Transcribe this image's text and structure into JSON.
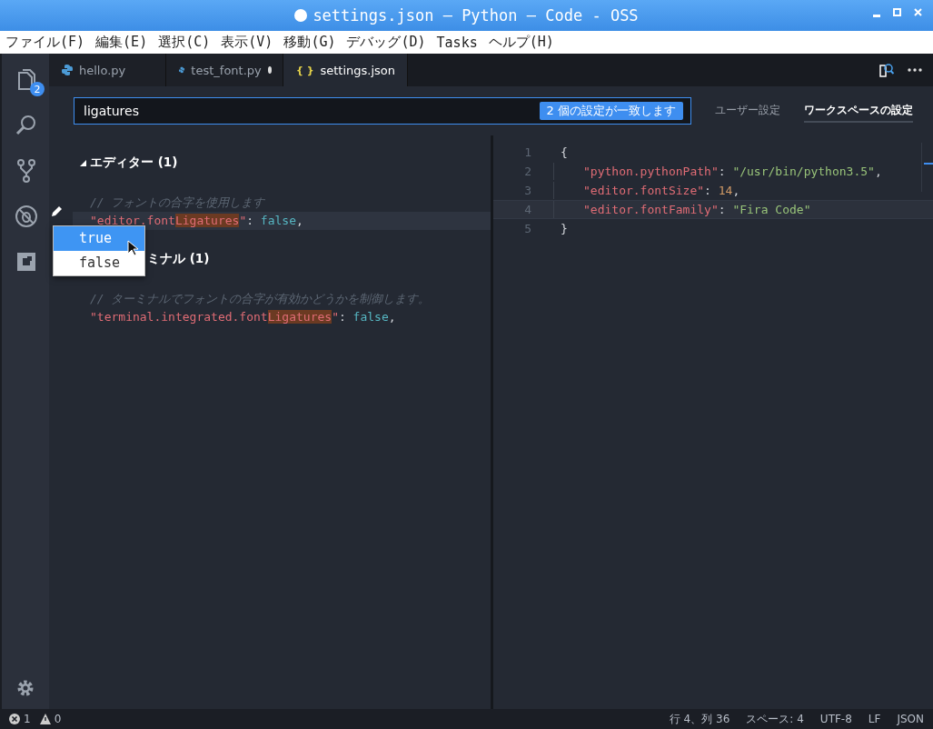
{
  "window": {
    "title": "settings.json — Python — Code - OSS",
    "dirty": true
  },
  "menu": [
    "ファイル(F)",
    "編集(E)",
    "選択(C)",
    "表示(V)",
    "移動(G)",
    "デバッグ(D)",
    "Tasks",
    "ヘルプ(H)"
  ],
  "activity_bar": [
    {
      "kind": "files",
      "badge": "2",
      "selected": false
    },
    {
      "kind": "search",
      "selected": false
    },
    {
      "kind": "git",
      "selected": false
    },
    {
      "kind": "debug",
      "selected": false
    },
    {
      "kind": "extensions",
      "selected": false
    }
  ],
  "tabs": [
    {
      "label": "hello.py",
      "kind": "python",
      "dirty": false,
      "selected": false
    },
    {
      "label": "test_font.py",
      "kind": "python",
      "dirty": true,
      "selected": false
    },
    {
      "label": "settings.json",
      "kind": "json",
      "icon_text": "{ }",
      "dirty": true,
      "selected": true
    }
  ],
  "search": {
    "value": "ligatures",
    "badge": "2 個の設定が一致します"
  },
  "scope_tabs": [
    {
      "label": "ユーザー設定",
      "selected": false
    },
    {
      "label": "ワークスペースの設定",
      "selected": true
    }
  ],
  "groups": [
    {
      "title": "エディター (1)",
      "expanded": true,
      "comment": "// フォントの合字を使用します",
      "tokens": [
        {
          "kind": "key",
          "text": "\"editor.font"
        },
        {
          "kind": "match",
          "text": "Ligatures"
        },
        {
          "kind": "key",
          "text": "\""
        },
        {
          "kind": "punct",
          "text": ": "
        },
        {
          "kind": "bool",
          "text": "false"
        },
        {
          "kind": "punct",
          "text": ","
        }
      ],
      "current": true
    },
    {
      "title": "ミナル (1)",
      "comment": "// ターミナルでフォントの合字が有効かどうかを制御します。",
      "tokens": [
        {
          "kind": "key",
          "text": "\"terminal.integrated.font"
        },
        {
          "kind": "match",
          "text": "Ligatures"
        },
        {
          "kind": "key",
          "text": "\""
        },
        {
          "kind": "punct",
          "text": ": "
        },
        {
          "kind": "bool",
          "text": "false"
        },
        {
          "kind": "punct",
          "text": ","
        }
      ],
      "current": false
    }
  ],
  "dropdown": [
    {
      "label": "true",
      "selected": true
    },
    {
      "label": "false",
      "selected": false
    }
  ],
  "editor": {
    "lines": [
      {
        "number": "1",
        "indent": false,
        "tokens": [
          {
            "kind": "punct",
            "text": "{"
          }
        ],
        "current": false
      },
      {
        "number": "2",
        "indent": true,
        "tokens": [
          {
            "kind": "key",
            "text": "\"python.pythonPath\""
          },
          {
            "kind": "punct",
            "text": ": "
          },
          {
            "kind": "string",
            "text": "\"/usr/bin/python3.5\""
          },
          {
            "kind": "punct",
            "text": ","
          }
        ],
        "current": false
      },
      {
        "number": "3",
        "indent": true,
        "tokens": [
          {
            "kind": "key",
            "text": "\"editor.fontSize\""
          },
          {
            "kind": "punct",
            "text": ": "
          },
          {
            "kind": "number",
            "text": "14"
          },
          {
            "kind": "punct",
            "text": ","
          }
        ],
        "current": false
      },
      {
        "number": "4",
        "indent": true,
        "tokens": [
          {
            "kind": "key",
            "text": "\"editor.fontFamily\""
          },
          {
            "kind": "punct",
            "text": ": "
          },
          {
            "kind": "string",
            "text": "\"Fira Code\""
          }
        ],
        "current": true
      },
      {
        "number": "5",
        "indent": false,
        "tokens": [
          {
            "kind": "punct",
            "text": "}"
          }
        ],
        "current": false
      }
    ]
  },
  "status_bar": {
    "errors": "1",
    "warnings": "0",
    "items": [
      "行 4、列 36",
      "スペース: 4",
      "UTF-8",
      "LF",
      "JSON"
    ]
  }
}
